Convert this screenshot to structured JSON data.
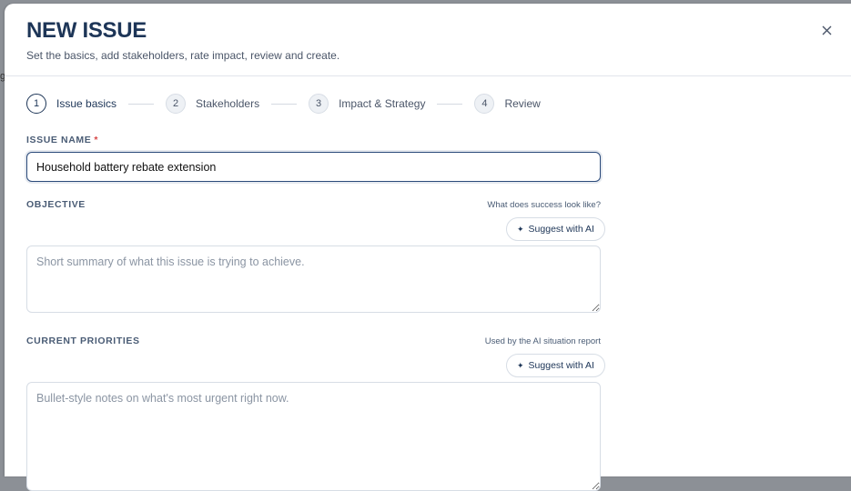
{
  "modal": {
    "title": "NEW ISSUE",
    "subtitle": "Set the basics, add stakeholders, rate impact, review and create.",
    "close_icon": "close-icon"
  },
  "steps": [
    {
      "number": "1",
      "label": "Issue basics",
      "active": true
    },
    {
      "number": "2",
      "label": "Stakeholders",
      "active": false
    },
    {
      "number": "3",
      "label": "Impact & Strategy",
      "active": false
    },
    {
      "number": "4",
      "label": "Review",
      "active": false
    }
  ],
  "issue_name": {
    "label": "ISSUE NAME",
    "required_mark": "*",
    "value": "Household battery rebate extension"
  },
  "objective": {
    "label": "OBJECTIVE",
    "hint": "What does success look like?",
    "ai_button": "Suggest with AI",
    "placeholder": "Short summary of what this issue is trying to achieve."
  },
  "priorities": {
    "label": "CURRENT PRIORITIES",
    "hint": "Used by the AI situation report",
    "ai_button": "Suggest with AI",
    "placeholder": "Bullet-style notes on what's most urgent right now."
  },
  "backdrop_glyph": "g"
}
